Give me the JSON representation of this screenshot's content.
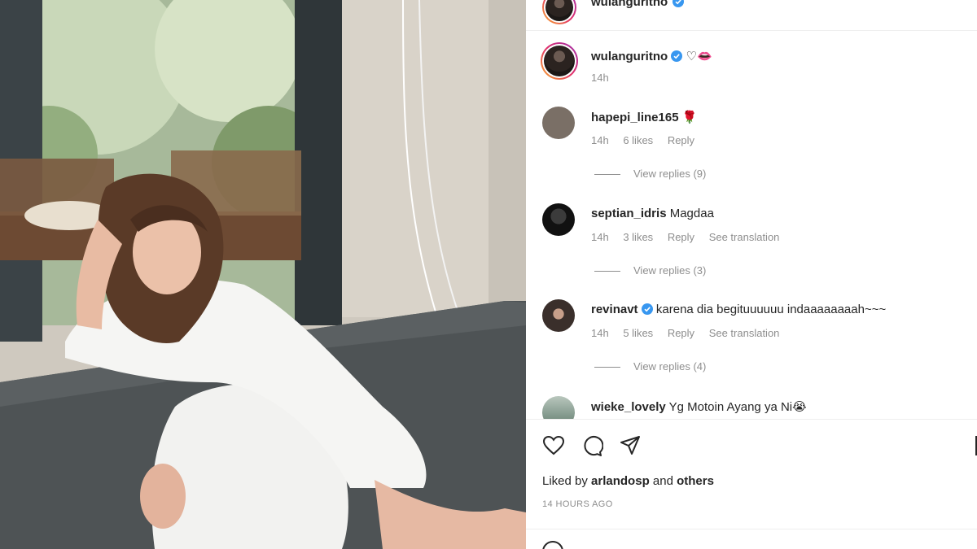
{
  "post": {
    "author": "wulanguritno",
    "caption_emojis": "♡👄",
    "caption_time": "14h",
    "liked_by_prefix": "Liked by",
    "liked_by_user": "arlandosp",
    "liked_by_and": "and",
    "liked_by_others": "others",
    "timestamp": "14 HOURS AGO"
  },
  "comments": [
    {
      "user": "hapepi_line165",
      "text": "🌹",
      "time": "14h",
      "likes": "6 likes",
      "reply": "Reply",
      "translation": "",
      "view_replies": "View replies (9)",
      "avatar_color": "#7a6f66"
    },
    {
      "user": "septian_idris",
      "text": "Magdaa",
      "time": "14h",
      "likes": "3 likes",
      "reply": "Reply",
      "translation": "See translation",
      "view_replies": "View replies (3)",
      "avatar_color": "#1b1b1b"
    },
    {
      "user": "revinavt",
      "text": "karena dia begituuuuuu indaaaaaaaah~~~",
      "time": "14h",
      "likes": "5 likes",
      "reply": "Reply",
      "translation": "See translation",
      "view_replies": "View replies (4)",
      "avatar_color": "#3a2f2b",
      "verified": true
    },
    {
      "user": "wieke_lovely",
      "text": "Yg Motoin Ayang ya Ni😭",
      "avatar_color": "#6f8a7d"
    }
  ],
  "icons": {
    "like": "heart-icon",
    "comment": "comment-icon",
    "share": "paper-plane-icon",
    "save": "bookmark-icon",
    "verified": "verified-badge-icon",
    "emoji": "emoji-icon"
  },
  "colors": {
    "verified": "#3897f0",
    "text": "#262626",
    "muted": "#8e8e8e"
  }
}
